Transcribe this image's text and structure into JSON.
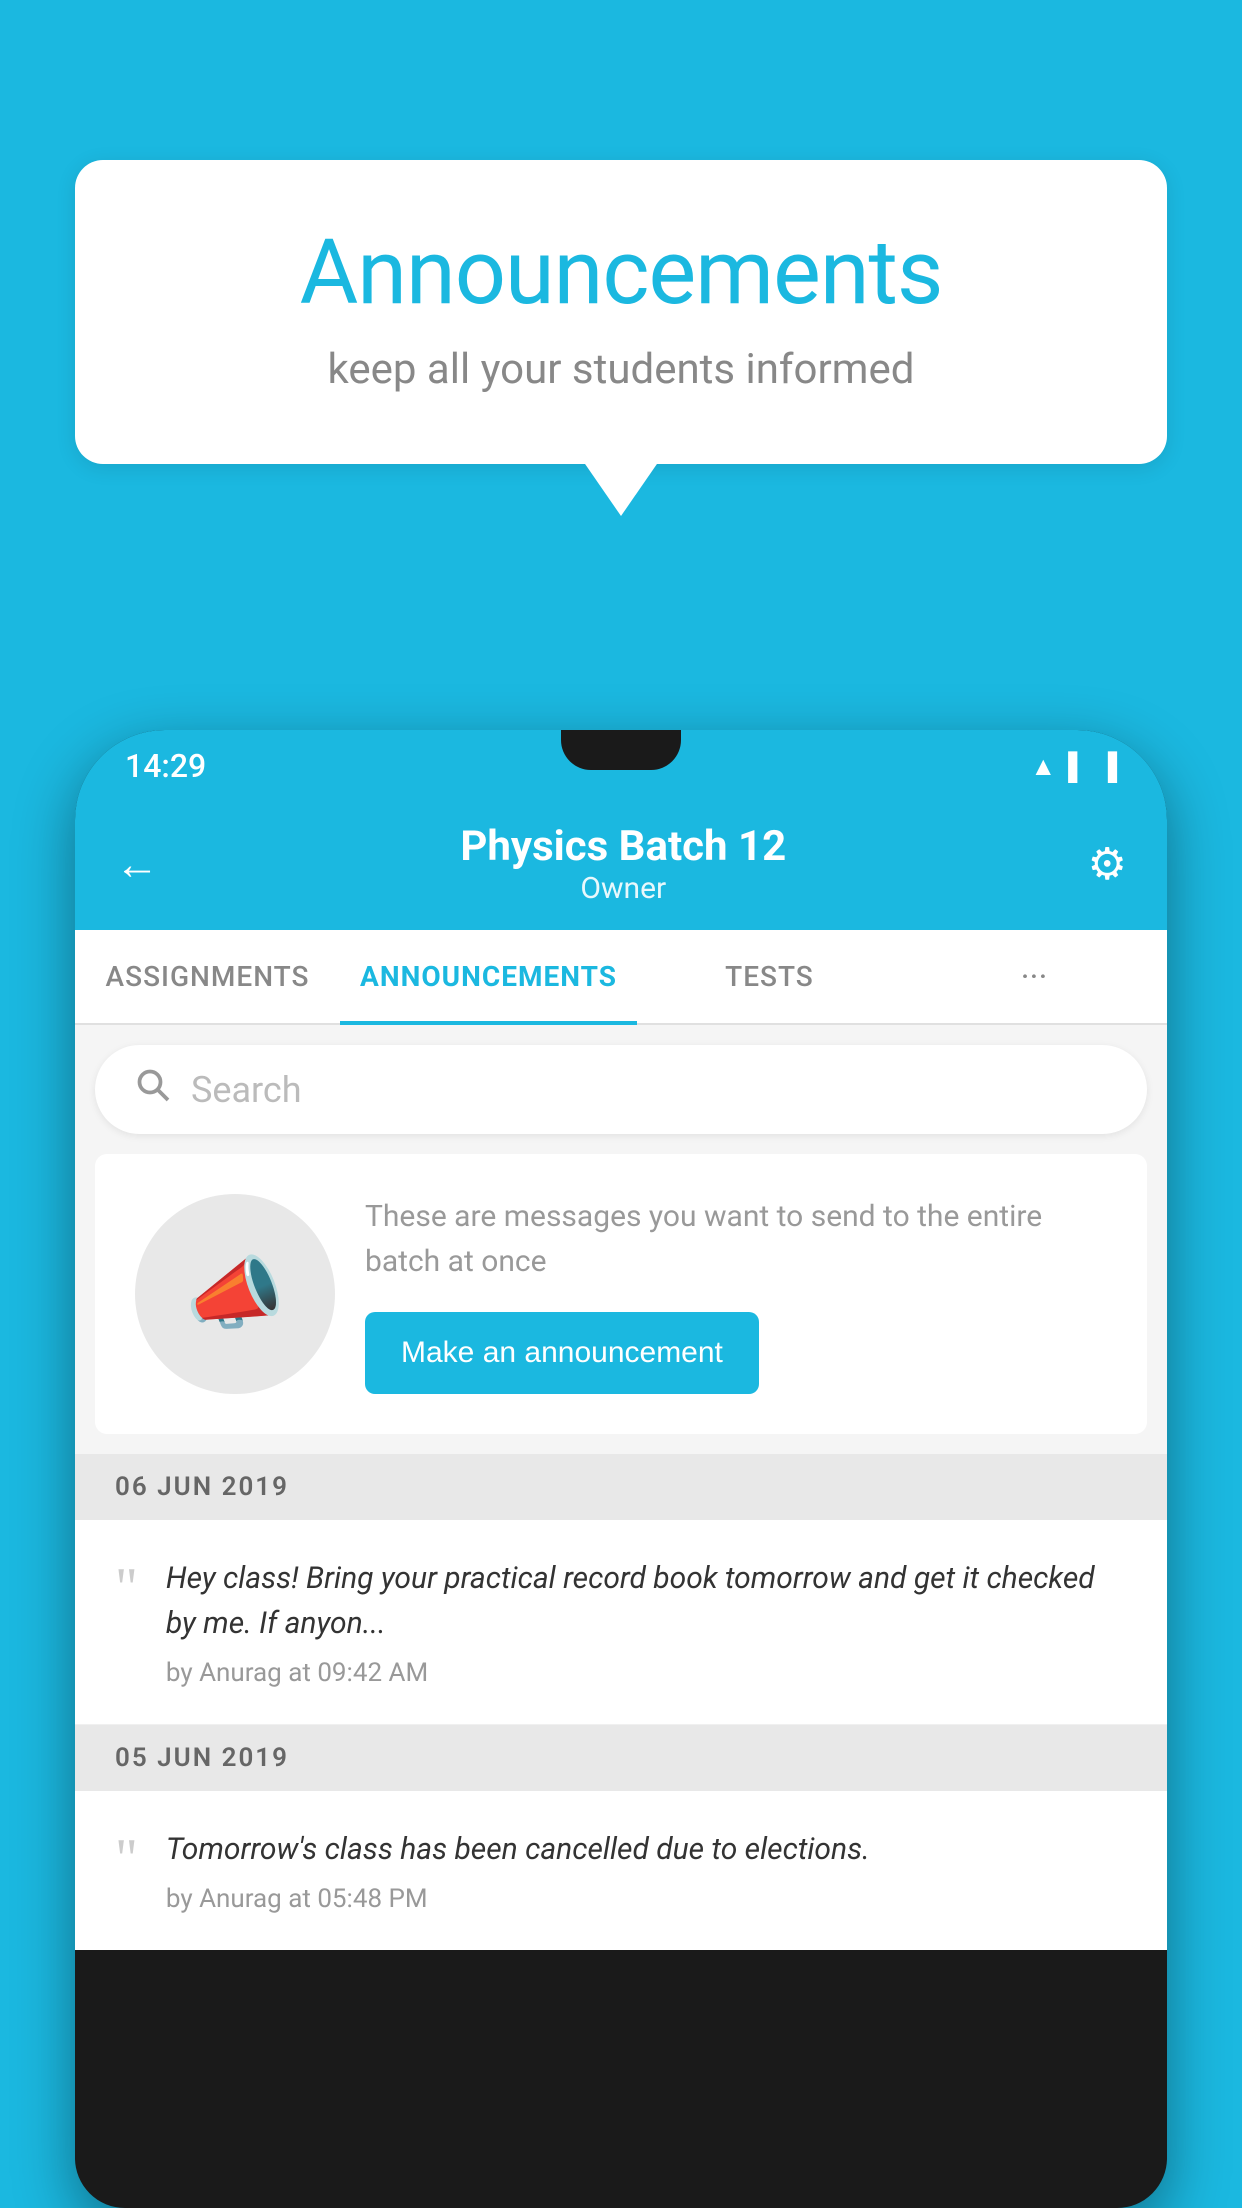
{
  "bubble": {
    "title": "Announcements",
    "subtitle": "keep all your students informed"
  },
  "status_bar": {
    "time": "14:29"
  },
  "header": {
    "title": "Physics Batch 12",
    "subtitle": "Owner",
    "back_label": "←",
    "gear_label": "⚙"
  },
  "tabs": [
    {
      "label": "ASSIGNMENTS",
      "active": false
    },
    {
      "label": "ANNOUNCEMENTS",
      "active": true
    },
    {
      "label": "TESTS",
      "active": false
    },
    {
      "label": "···",
      "active": false
    }
  ],
  "search": {
    "placeholder": "Search"
  },
  "prompt": {
    "text": "These are messages you want to send to the entire batch at once",
    "button_label": "Make an announcement"
  },
  "dates": [
    {
      "label": "06  JUN  2019",
      "announcements": [
        {
          "text": "Hey class! Bring your practical record book tomorrow and get it checked by me. If anyon...",
          "meta": "by Anurag at 09:42 AM"
        }
      ]
    },
    {
      "label": "05  JUN  2019",
      "announcements": [
        {
          "text": "Tomorrow's class has been cancelled due to elections.",
          "meta": "by Anurag at 05:48 PM"
        }
      ]
    }
  ]
}
